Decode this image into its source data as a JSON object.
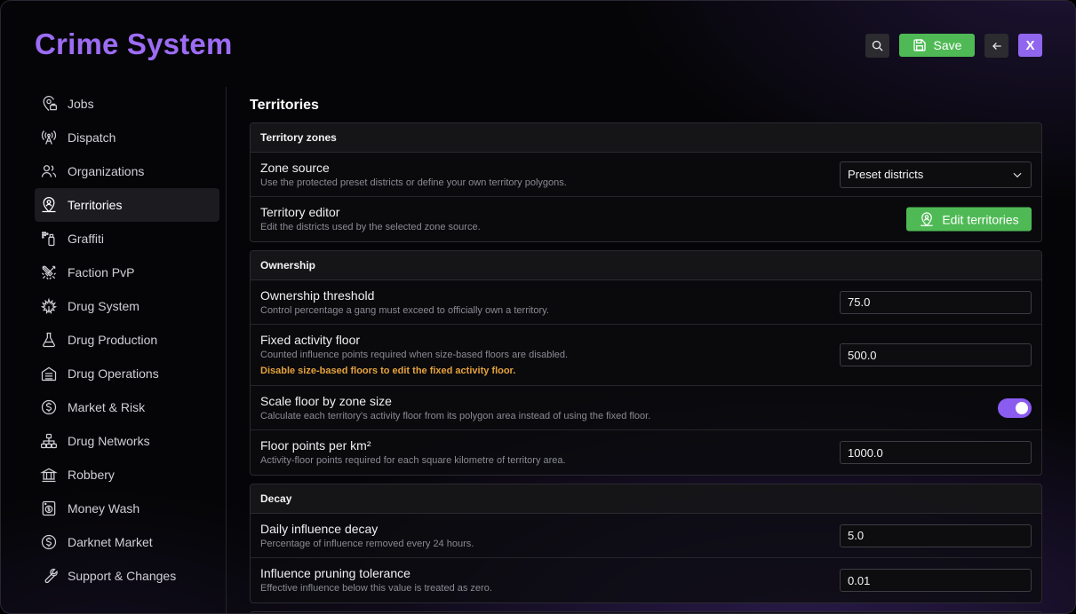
{
  "app": {
    "title": "Crime System"
  },
  "toolbar": {
    "save_label": "Save",
    "close_label": "X"
  },
  "sidebar": {
    "items": [
      {
        "label": "Jobs",
        "icon": "map-pin-briefcase-icon"
      },
      {
        "label": "Dispatch",
        "icon": "antenna-icon"
      },
      {
        "label": "Organizations",
        "icon": "users-icon"
      },
      {
        "label": "Territories",
        "icon": "map-pin-user-icon",
        "active": true
      },
      {
        "label": "Graffiti",
        "icon": "spray-can-icon"
      },
      {
        "label": "Faction PvP",
        "icon": "crossed-swords-icon"
      },
      {
        "label": "Drug System",
        "icon": "leaf-icon"
      },
      {
        "label": "Drug Production",
        "icon": "flask-icon"
      },
      {
        "label": "Drug Operations",
        "icon": "building-icon"
      },
      {
        "label": "Market & Risk",
        "icon": "dollar-circle-icon"
      },
      {
        "label": "Drug Networks",
        "icon": "network-icon"
      },
      {
        "label": "Robbery",
        "icon": "bank-icon"
      },
      {
        "label": "Money Wash",
        "icon": "washing-machine-icon"
      },
      {
        "label": "Darknet Market",
        "icon": "dollar-circle-icon"
      },
      {
        "label": "Support & Changes",
        "icon": "wrench-icon"
      }
    ]
  },
  "main": {
    "title": "Territories",
    "zones": {
      "header": "Territory zones",
      "zone_source": {
        "label": "Zone source",
        "desc": "Use the protected preset districts or define your own territory polygons.",
        "value": "Preset districts"
      },
      "editor": {
        "label": "Territory editor",
        "desc": "Edit the districts used by the selected zone source.",
        "button": "Edit territories"
      }
    },
    "ownership": {
      "header": "Ownership",
      "threshold": {
        "label": "Ownership threshold",
        "desc": "Control percentage a gang must exceed to officially own a territory.",
        "value": "75.0"
      },
      "floor": {
        "label": "Fixed activity floor",
        "desc": "Counted influence points required when size-based floors are disabled.",
        "warn": "Disable size-based floors to edit the fixed activity floor.",
        "value": "500.0"
      },
      "scale": {
        "label": "Scale floor by zone size",
        "desc": "Calculate each territory's activity floor from its polygon area instead of using the fixed floor.",
        "enabled": true
      },
      "per_km": {
        "label": "Floor points per km²",
        "desc": "Activity-floor points required for each square kilometre of territory area.",
        "value": "1000.0"
      }
    },
    "decay": {
      "header": "Decay",
      "daily": {
        "label": "Daily influence decay",
        "desc": "Percentage of influence removed every 24 hours.",
        "value": "5.0"
      },
      "pruning": {
        "label": "Influence pruning tolerance",
        "desc": "Effective influence below this value is treated as zero.",
        "value": "0.01"
      }
    }
  },
  "colors": {
    "accent": "#9d6cf5",
    "save_green": "#4fba55",
    "warning": "#e6a23c",
    "toggle": "#8b5cf0"
  }
}
